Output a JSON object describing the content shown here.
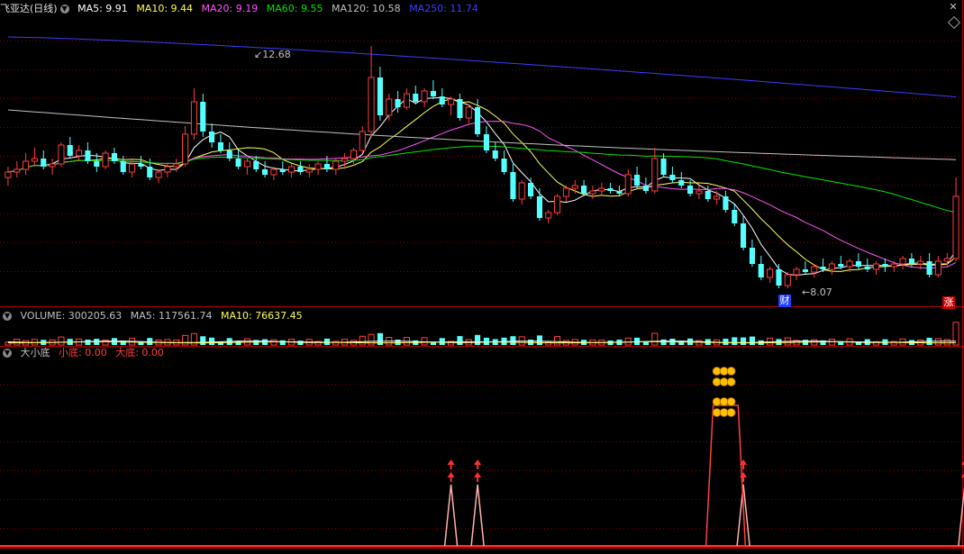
{
  "main_header": {
    "stock_name": "飞亚达(日线)",
    "ma5": "MA5: 9.91",
    "ma10": "MA10: 9.44",
    "ma20": "MA20: 9.19",
    "ma60": "MA60: 9.55",
    "ma120": "MA120: 10.58",
    "ma250": "MA250: 11.74",
    "high_label": "12.68",
    "low_label": "8.07",
    "cai_badge": "财",
    "zhang_badge": "涨"
  },
  "volume_header": {
    "title": "VOLUME: 300205.63",
    "ma5": "MA5: 117561.74",
    "ma10": "MA10: 76637.45"
  },
  "indicator_header": {
    "name": "大小底",
    "small": "小底: 0.00",
    "big": "大底: 0.00"
  },
  "icons": {
    "collapse": "chevron-down-icon",
    "close": "close-icon",
    "expand": "diamond-icon"
  },
  "colors": {
    "up": "#ff3c3c",
    "down": "#54ffff",
    "ma5": "#ffffff",
    "ma10": "#ffff54",
    "ma20": "#ff54ff",
    "ma60": "#00e600",
    "ma120": "#c0c0c0",
    "ma250": "#3c3cff",
    "frame": "#b00000",
    "signal": "#ff3030"
  },
  "chart_data": [
    {
      "type": "candlestick",
      "title": "飞亚达(日线)",
      "ylim": [
        7.9,
        13.2
      ],
      "high_marker": 12.68,
      "low_marker": 8.07,
      "ohlc": [
        [
          10.25,
          10.45,
          10.1,
          10.35
        ],
        [
          10.35,
          10.55,
          10.25,
          10.4
        ],
        [
          10.4,
          10.7,
          10.3,
          10.55
        ],
        [
          10.55,
          10.8,
          10.45,
          10.6
        ],
        [
          10.6,
          10.75,
          10.4,
          10.45
        ],
        [
          10.45,
          10.6,
          10.3,
          10.5
        ],
        [
          10.5,
          10.9,
          10.45,
          10.85
        ],
        [
          10.85,
          11.0,
          10.6,
          10.65
        ],
        [
          10.65,
          10.85,
          10.55,
          10.75
        ],
        [
          10.75,
          10.9,
          10.5,
          10.55
        ],
        [
          10.55,
          10.7,
          10.35,
          10.45
        ],
        [
          10.45,
          10.75,
          10.4,
          10.7
        ],
        [
          10.7,
          10.8,
          10.5,
          10.55
        ],
        [
          10.55,
          10.65,
          10.3,
          10.35
        ],
        [
          10.35,
          10.55,
          10.25,
          10.5
        ],
        [
          10.5,
          10.65,
          10.4,
          10.45
        ],
        [
          10.45,
          10.6,
          10.2,
          10.25
        ],
        [
          10.25,
          10.4,
          10.15,
          10.35
        ],
        [
          10.35,
          10.5,
          10.25,
          10.45
        ],
        [
          10.45,
          10.6,
          10.35,
          10.5
        ],
        [
          10.5,
          11.2,
          10.45,
          11.05
        ],
        [
          11.05,
          11.9,
          10.95,
          11.65
        ],
        [
          11.65,
          11.8,
          11.0,
          11.1
        ],
        [
          11.1,
          11.25,
          10.8,
          10.9
        ],
        [
          10.9,
          11.05,
          10.7,
          10.75
        ],
        [
          10.75,
          10.9,
          10.55,
          10.6
        ],
        [
          10.6,
          10.75,
          10.4,
          10.45
        ],
        [
          10.45,
          10.6,
          10.3,
          10.55
        ],
        [
          10.55,
          10.65,
          10.35,
          10.4
        ],
        [
          10.4,
          10.55,
          10.25,
          10.3
        ],
        [
          10.3,
          10.45,
          10.2,
          10.4
        ],
        [
          10.4,
          10.55,
          10.3,
          10.35
        ],
        [
          10.35,
          10.5,
          10.25,
          10.45
        ],
        [
          10.45,
          10.55,
          10.3,
          10.35
        ],
        [
          10.35,
          10.5,
          10.25,
          10.4
        ],
        [
          10.4,
          10.55,
          10.3,
          10.5
        ],
        [
          10.5,
          10.65,
          10.35,
          10.4
        ],
        [
          10.4,
          10.6,
          10.3,
          10.55
        ],
        [
          10.55,
          10.7,
          10.45,
          10.6
        ],
        [
          10.6,
          10.8,
          10.5,
          10.75
        ],
        [
          10.75,
          11.2,
          10.7,
          11.1
        ],
        [
          11.1,
          12.68,
          11.0,
          12.1
        ],
        [
          12.1,
          12.3,
          11.3,
          11.4
        ],
        [
          11.4,
          11.8,
          11.3,
          11.7
        ],
        [
          11.7,
          11.85,
          11.45,
          11.55
        ],
        [
          11.55,
          11.9,
          11.5,
          11.8
        ],
        [
          11.8,
          11.95,
          11.6,
          11.65
        ],
        [
          11.65,
          11.9,
          11.55,
          11.85
        ],
        [
          11.85,
          12.05,
          11.7,
          11.75
        ],
        [
          11.75,
          11.9,
          11.55,
          11.6
        ],
        [
          11.6,
          11.75,
          11.4,
          11.7
        ],
        [
          11.7,
          11.8,
          11.3,
          11.35
        ],
        [
          11.35,
          11.6,
          11.25,
          11.55
        ],
        [
          11.55,
          11.7,
          11.0,
          11.05
        ],
        [
          11.05,
          11.2,
          10.7,
          10.75
        ],
        [
          10.75,
          10.9,
          10.55,
          10.6
        ],
        [
          10.6,
          10.75,
          10.3,
          10.35
        ],
        [
          10.35,
          10.5,
          9.8,
          9.85
        ],
        [
          9.85,
          10.2,
          9.75,
          10.15
        ],
        [
          10.15,
          10.25,
          9.85,
          9.9
        ],
        [
          9.9,
          10.05,
          9.45,
          9.5
        ],
        [
          9.5,
          9.65,
          9.4,
          9.6
        ],
        [
          9.6,
          9.95,
          9.55,
          9.9
        ],
        [
          9.9,
          10.1,
          9.8,
          10.05
        ],
        [
          10.05,
          10.2,
          9.95,
          10.1
        ],
        [
          10.1,
          10.2,
          9.9,
          9.95
        ],
        [
          9.95,
          10.1,
          9.85,
          10.0
        ],
        [
          10.0,
          10.15,
          9.9,
          10.05
        ],
        [
          10.05,
          10.15,
          9.95,
          10.0
        ],
        [
          10.0,
          10.1,
          9.9,
          9.95
        ],
        [
          9.95,
          10.4,
          9.9,
          10.3
        ],
        [
          10.3,
          10.45,
          10.05,
          10.1
        ],
        [
          10.1,
          10.25,
          9.95,
          10.0
        ],
        [
          10.0,
          10.8,
          9.95,
          10.6
        ],
        [
          10.6,
          10.7,
          10.25,
          10.3
        ],
        [
          10.3,
          10.45,
          10.15,
          10.2
        ],
        [
          10.2,
          10.35,
          10.05,
          10.1
        ],
        [
          10.1,
          10.2,
          9.9,
          9.95
        ],
        [
          9.95,
          10.1,
          9.85,
          10.0
        ],
        [
          10.0,
          10.1,
          9.8,
          9.85
        ],
        [
          9.85,
          10.0,
          9.75,
          9.9
        ],
        [
          9.9,
          10.0,
          9.6,
          9.65
        ],
        [
          9.65,
          9.75,
          9.35,
          9.4
        ],
        [
          9.4,
          9.55,
          8.9,
          8.95
        ],
        [
          8.95,
          9.1,
          8.6,
          8.65
        ],
        [
          8.65,
          8.8,
          8.35,
          8.4
        ],
        [
          8.4,
          8.6,
          8.3,
          8.55
        ],
        [
          8.55,
          8.65,
          8.2,
          8.25
        ],
        [
          8.25,
          8.5,
          8.2,
          8.45
        ],
        [
          8.45,
          8.6,
          8.35,
          8.55
        ],
        [
          8.55,
          8.7,
          8.45,
          8.5
        ],
        [
          8.5,
          8.65,
          8.4,
          8.6
        ],
        [
          8.6,
          8.75,
          8.5,
          8.55
        ],
        [
          8.55,
          8.7,
          8.45,
          8.65
        ],
        [
          8.65,
          8.8,
          8.55,
          8.6
        ],
        [
          8.6,
          8.75,
          8.5,
          8.7
        ],
        [
          8.7,
          8.85,
          8.55,
          8.6
        ],
        [
          8.6,
          8.75,
          8.5,
          8.55
        ],
        [
          8.55,
          8.7,
          8.45,
          8.65
        ],
        [
          8.65,
          8.75,
          8.5,
          8.6
        ],
        [
          8.6,
          8.7,
          8.5,
          8.65
        ],
        [
          8.65,
          8.8,
          8.55,
          8.75
        ],
        [
          8.75,
          8.85,
          8.6,
          8.65
        ],
        [
          8.65,
          8.8,
          8.55,
          8.7
        ],
        [
          8.7,
          8.85,
          8.4,
          8.45
        ],
        [
          8.45,
          8.8,
          8.4,
          8.7
        ],
        [
          8.7,
          8.85,
          8.6,
          8.75
        ],
        [
          8.75,
          10.25,
          8.7,
          9.9
        ]
      ],
      "ma_series": [
        {
          "name": "MA5",
          "color": "#ffffff"
        },
        {
          "name": "MA10",
          "color": "#ffff54"
        },
        {
          "name": "MA20",
          "color": "#ff54ff"
        },
        {
          "name": "MA60",
          "color": "#00e600"
        },
        {
          "name": "MA120",
          "color": "#c0c0c0",
          "start": 11.5,
          "end": 10.58
        },
        {
          "name": "MA250",
          "color": "#3c3cff",
          "start": 12.85,
          "end": 11.74
        }
      ]
    },
    {
      "type": "bar",
      "title": "VOLUME: 300205.63",
      "ma5": 117561.74,
      "ma10": 76637.45,
      "last_value": 300205.63
    },
    {
      "type": "line",
      "title": "大小底",
      "series": [
        {
          "name": "小底",
          "last_value": 0.0,
          "peaks": [
            50,
            53,
            83,
            108
          ]
        },
        {
          "name": "大底",
          "last_value": 0.0,
          "peaks": [
            80,
            81,
            82
          ]
        }
      ]
    }
  ]
}
